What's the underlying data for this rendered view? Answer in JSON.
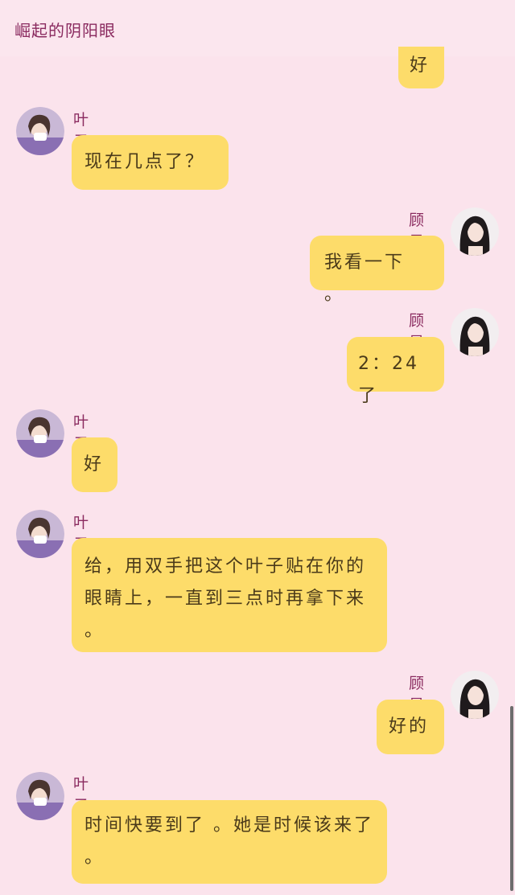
{
  "header": {
    "title": "崛起的阴阳眼"
  },
  "participants": {
    "left": {
      "name": "叶子"
    },
    "right": {
      "name": "顾星"
    }
  },
  "messages": [
    {
      "side": "right",
      "name": "",
      "text": "好"
    },
    {
      "side": "left",
      "name": "叶子",
      "text": "现在几点了？"
    },
    {
      "side": "right",
      "name": "顾星",
      "text": "我看一下 。"
    },
    {
      "side": "right",
      "name": "顾星",
      "text": "2：24了"
    },
    {
      "side": "left",
      "name": "叶子",
      "text": "好"
    },
    {
      "side": "left",
      "name": "叶子",
      "text": "给，用双手把这个叶子贴在你的眼睛上，一直到三点时再拿下来 。"
    },
    {
      "side": "right",
      "name": "顾星",
      "text": "好的"
    },
    {
      "side": "left",
      "name": "叶子",
      "text": "时间快要到了 。她是时候该来了 。"
    }
  ],
  "colors": {
    "background": "#fbe3ec",
    "bubble": "#fddc6a",
    "name": "#8a2a5f"
  }
}
